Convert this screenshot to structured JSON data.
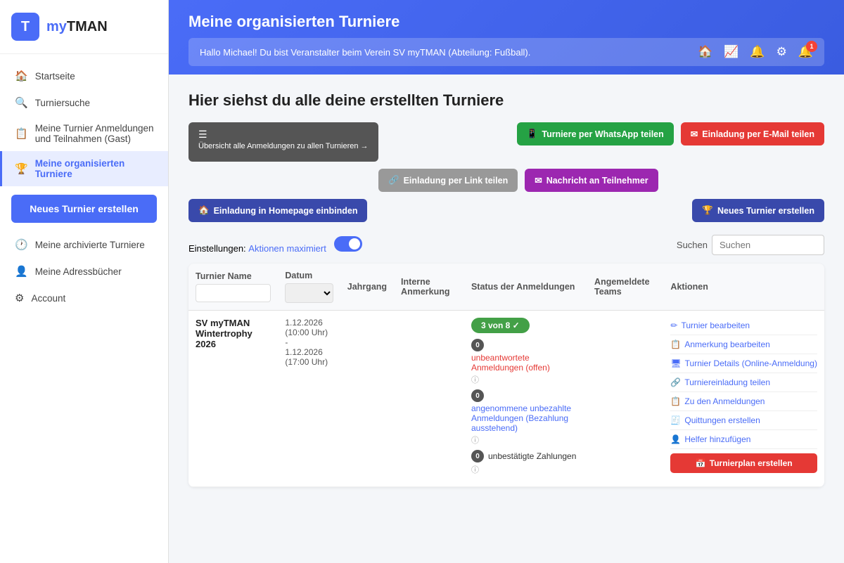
{
  "app": {
    "logo_letter": "T",
    "logo_name_part1": "my",
    "logo_name_part2": "TMAN"
  },
  "sidebar": {
    "items": [
      {
        "id": "startseite",
        "label": "Startseite",
        "icon": "🏠"
      },
      {
        "id": "turniersuche",
        "label": "Turniersuche",
        "icon": "🔍"
      },
      {
        "id": "anmeldungen",
        "label": "Meine Turnier Anmeldungen und Teilnahmen (Gast)",
        "icon": "📋"
      },
      {
        "id": "meine-turniere",
        "label": "Meine organisierten Turniere",
        "icon": "🏆",
        "active": true
      },
      {
        "id": "archiv",
        "label": "Meine archivierte Turniere",
        "icon": "🕐"
      },
      {
        "id": "adressbuecher",
        "label": "Meine Adressbücher",
        "icon": "👤"
      },
      {
        "id": "account",
        "label": "Account",
        "icon": "⚙"
      }
    ],
    "new_button_label": "Neues Turnier erstellen"
  },
  "header": {
    "title": "Meine organisierten Turniere",
    "message": "Hallo Michael! Du bist Veranstalter beim Verein SV myTMAN (Abteilung: Fußball).",
    "notification_count": "1",
    "icons": [
      "🏠",
      "📈",
      "🔔",
      "⚙",
      "🔔"
    ]
  },
  "page": {
    "title": "Hier siehst du alle deine erstellten Turniere"
  },
  "toolbar": {
    "btn_overview": "Übersicht alle Anmeldungen zu allen Turnieren →",
    "btn_overview_icon": "☰",
    "btn_whatsapp": "Turniere per WhatsApp teilen",
    "btn_whatsapp_icon": "📱",
    "btn_email": "Einladung per E-Mail teilen",
    "btn_email_icon": "✉",
    "btn_link": "Einladung per Link teilen",
    "btn_link_icon": "🔗",
    "btn_nachricht": "Nachricht an Teilnehmer",
    "btn_nachricht_icon": "✉",
    "btn_homepage": "Einladung in Homepage einbinden",
    "btn_homepage_icon": "🏠",
    "btn_new": "Neues Turnier erstellen",
    "btn_new_icon": "🏆"
  },
  "settings": {
    "label": "Einstellungen:",
    "value": "Aktionen maximiert",
    "toggle_state": true,
    "search_placeholder": "Suchen"
  },
  "table": {
    "columns": [
      "Turnier Name",
      "Datum",
      "Jahrgang",
      "Interne Anmerkung",
      "Status der Anmeldungen",
      "Angemeldete Teams",
      "Aktionen"
    ],
    "rows": [
      {
        "name": "SV myTMAN Wintertrophy 2026",
        "date_from": "1.12.2026 (10:00 Uhr)",
        "date_to": "1.12.2026 (17:00 Uhr)",
        "jahrgang": "",
        "anmerkung": "",
        "status": {
          "badge_green": "3 von 8 ✓",
          "row1_count": "0",
          "row1_text": "unbeantwortete Anmeldungen (offen)",
          "row2_count": "0",
          "row2_text": "angenommene unbezahlte Anmeldungen (Bezahlung ausstehend)",
          "row3_count": "0",
          "row3_text": "unbestätigte Zahlungen"
        },
        "actions": [
          {
            "icon": "✏",
            "label": "Turnier bearbeiten"
          },
          {
            "icon": "📋",
            "label": "Anmerkung bearbeiten"
          },
          {
            "icon": "🖥",
            "label": "Turnier Details (Online-Anmeldung)"
          },
          {
            "icon": "🔗",
            "label": "Turniereinladung teilen"
          },
          {
            "icon": "📋",
            "label": "Zu den Anmeldungen"
          },
          {
            "icon": "🧾",
            "label": "Quittungen erstellen"
          },
          {
            "icon": "👤",
            "label": "Helfer hinzufügen"
          },
          {
            "icon": "📅",
            "label": "Turnierplan erstellen",
            "style": "red-pill"
          }
        ]
      }
    ]
  }
}
